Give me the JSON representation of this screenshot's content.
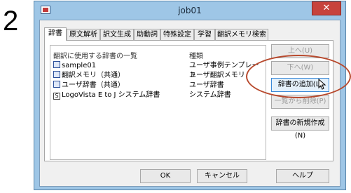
{
  "step_number": "2",
  "window": {
    "title": "job01",
    "close_label": "✕"
  },
  "tabs": [
    "辞書",
    "原文解析",
    "訳文生成",
    "助動詞",
    "特殊設定",
    "学習",
    "翻訳メモリ検索"
  ],
  "list": {
    "headers": [
      "翻訳に使用する辞書の一覧",
      "種類"
    ],
    "rows": [
      {
        "name": "sample01",
        "type": "ユーザ事例テンプレート",
        "icon": "template-dictionary-icon"
      },
      {
        "name": "翻訳メモリ（共通）",
        "type": "ユーザ翻訳メモリ",
        "icon": "translation-memory-icon"
      },
      {
        "name": "ユーザ辞書（共通）",
        "type": "ユーザ辞書",
        "icon": "user-dictionary-icon"
      },
      {
        "name": "LogoVista E to J システム辞書",
        "type": "システム辞書",
        "icon": "system-dictionary-icon"
      }
    ]
  },
  "side_buttons": {
    "up": "上へ(U)",
    "down": "下へ(W)",
    "add": "辞書の追加(L)",
    "remove": "一覧から削除(P)",
    "new": "辞書の新規作成(N)"
  },
  "footer": {
    "ok": "OK",
    "cancel": "キャンセル",
    "help": "ヘルプ"
  },
  "colors": {
    "titlebar": "#9ec6e6",
    "close": "#c7433c",
    "highlight_oval": "#b84a2e"
  }
}
